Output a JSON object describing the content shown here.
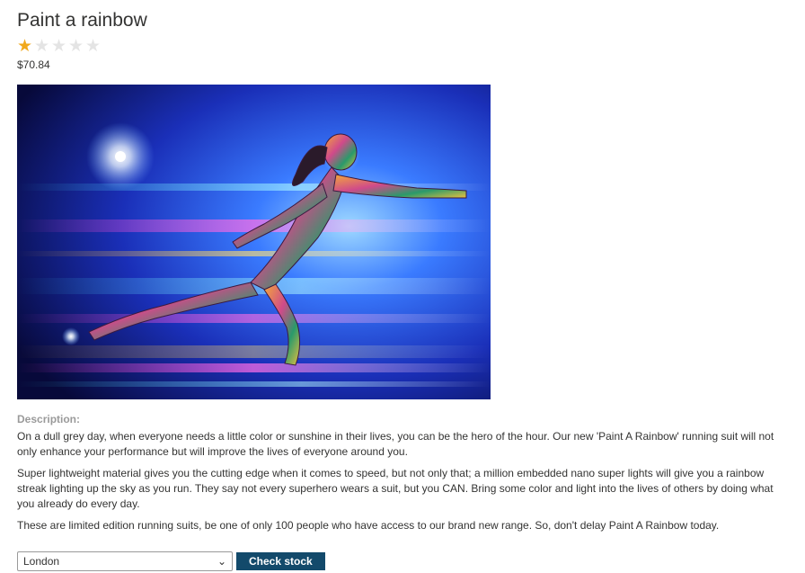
{
  "product": {
    "title": "Paint a rainbow",
    "rating": 1,
    "rating_max": 5,
    "price": "$70.84"
  },
  "description": {
    "label": "Description:",
    "paragraphs": [
      "On a dull grey day, when everyone needs a little color or sunshine in their lives, you can be the hero of the hour. Our new 'Paint A Rainbow' running suit will not only enhance your performance but will improve the lives of everyone around you.",
      "Super lightweight material gives you the cutting edge when it comes to speed, but not only that; a million embedded nano super lights will give you a rainbow streak lighting up the sky as you run. They say not every superhero wears a suit, but you CAN. Bring some color and light into the lives of others by doing what you already do every day.",
      "These are limited edition running suits, be one of only 100 people who have access to our brand new range. So, don't delay Paint A Rainbow today."
    ]
  },
  "stock": {
    "selected_store": "London",
    "button_label": "Check stock"
  },
  "colors": {
    "star_active": "#f1a91d",
    "star_inactive": "#e4e4e4",
    "button_bg": "#134a6b"
  }
}
